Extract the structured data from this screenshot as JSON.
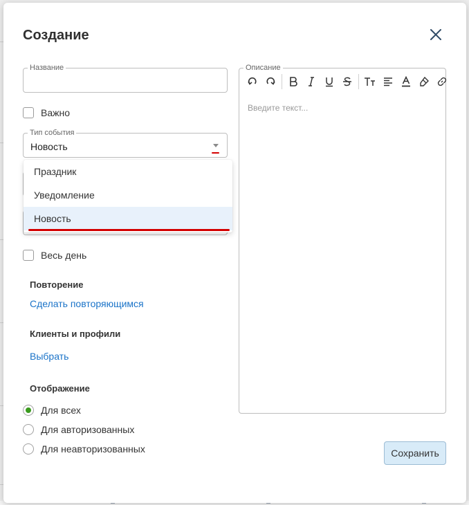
{
  "dialog": {
    "title": "Создание",
    "close_icon": "close-icon"
  },
  "form": {
    "name_field": {
      "label": "Название",
      "value": "",
      "placeholder": ""
    },
    "important": {
      "label": "Важно",
      "checked": false
    },
    "event_type": {
      "label": "Тип события",
      "value": "Новость",
      "options": [
        "Праздник",
        "Уведомление",
        "Новость"
      ],
      "selected_index": 2
    },
    "all_day": {
      "label": "Весь день",
      "checked": false
    },
    "repeat": {
      "title": "Повторение",
      "link": "Сделать повторяющимся"
    },
    "clients": {
      "title": "Клиенты и профили",
      "link": "Выбрать"
    },
    "display": {
      "title": "Отображение",
      "options": [
        "Для всех",
        "Для авторизованных",
        "Для неавторизованных"
      ],
      "selected_index": 0
    }
  },
  "description": {
    "label": "Описание",
    "placeholder": "Введите текст...",
    "toolbar": [
      "undo-icon",
      "redo-icon",
      "bold-icon",
      "italic-icon",
      "underline-icon",
      "strikethrough-icon",
      "text-size-icon",
      "align-left-icon",
      "font-color-icon",
      "highlight-icon",
      "link-icon"
    ]
  },
  "actions": {
    "save_label": "Сохранить"
  },
  "colors": {
    "accent_link": "#1a73c8",
    "radio_checked": "#3a9b1e",
    "annotation_red": "#d40000",
    "save_button_bg": "#d8ebf8",
    "selected_option_bg": "#e8f1fb"
  }
}
